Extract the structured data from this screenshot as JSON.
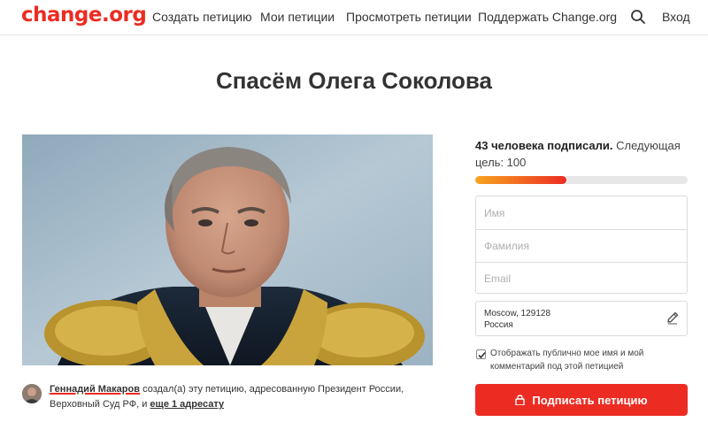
{
  "header": {
    "logo": "change.org",
    "nav": {
      "create": "Создать петицию",
      "mine": "Мои петиции",
      "browse": "Просмотреть петиции",
      "support": "Поддержать Change.org"
    },
    "search_icon": "search-icon",
    "login": "Вход"
  },
  "petition": {
    "title": "Спасём Олега Соколова",
    "photo_icon": "petition-photo"
  },
  "creator": {
    "name": "Геннадий Макаров",
    "text_before": " создал(а) эту петицию, адресованную Президент России, Верховный Суд РФ, и ",
    "more_link": "еще 1 адресату"
  },
  "signatures": {
    "count_text": "43 человека подписали.",
    "goal_text": " Следующая цель: 100",
    "progress_fraction": 0.43
  },
  "form": {
    "first_name_placeholder": "Имя",
    "last_name_placeholder": "Фамилия",
    "email_placeholder": "Email",
    "location_line1": "Moscow, 129128",
    "location_line2": "Россия",
    "edit_icon": "pencil-icon",
    "public_checkbox_label": "Отображать публично мое имя и мой комментарий под этой петицией",
    "public_checked": true,
    "sign_button": "Подписать петицию",
    "lock_icon": "lock-icon"
  },
  "colors": {
    "brand_red": "#ec2c22",
    "progress_start": "#f8a41f",
    "progress_end": "#ec2c22"
  }
}
